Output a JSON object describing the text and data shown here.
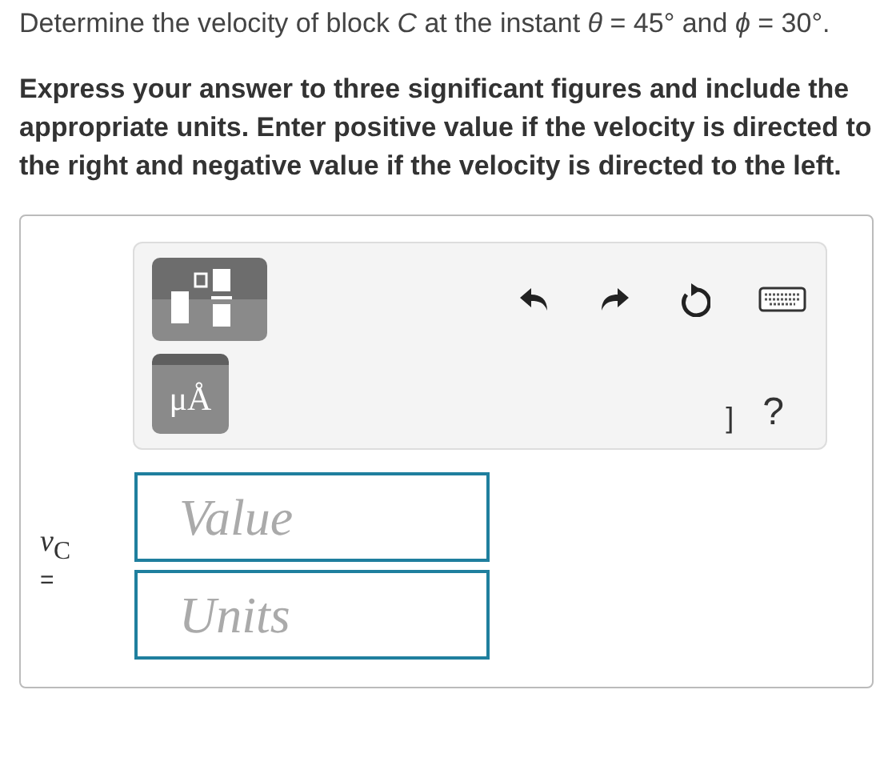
{
  "question": "Determine the velocity of block *C* at the instant *θ* = 45° and *ϕ* = 30°.",
  "instructions": "Express your answer to three significant figures and include the appropriate units. Enter positive value if the velocity is directed to the right and negative value if the velocity is directed to the left.",
  "toolbar": {
    "units_button": "μÅ",
    "bracket": "]",
    "help": "?"
  },
  "answer": {
    "label": "*v*$_{C}$",
    "equals": "=",
    "value": {
      "placeholder": "Value"
    },
    "units": {
      "placeholder": "Units"
    }
  }
}
